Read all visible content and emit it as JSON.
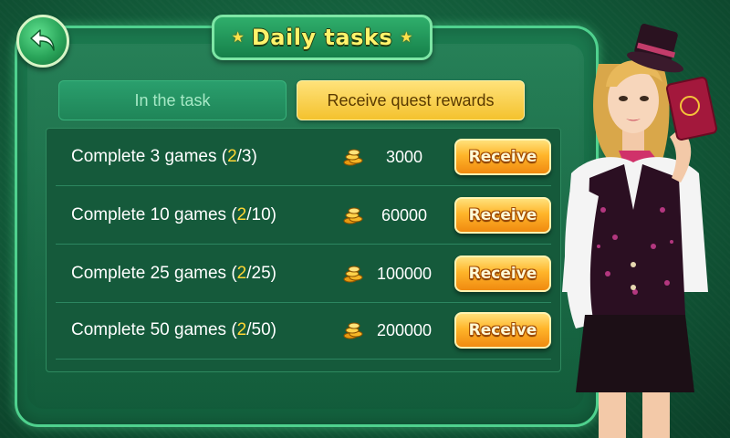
{
  "header": {
    "title": "Daily tasks",
    "star_glyph": "★",
    "back_icon": "back-arrow-icon"
  },
  "tabs": [
    {
      "label": "In the task",
      "active": false
    },
    {
      "label": "Receive quest rewards",
      "active": true
    }
  ],
  "tasks": [
    {
      "prefix": "Complete 3 games (",
      "done": "2",
      "suffix": "/3)",
      "reward": "3000",
      "button": "Receive"
    },
    {
      "prefix": "Complete 10 games (",
      "done": "2",
      "suffix": "/10)",
      "reward": "60000",
      "button": "Receive"
    },
    {
      "prefix": "Complete 25 games (",
      "done": "2",
      "suffix": "/25)",
      "reward": "100000",
      "button": "Receive"
    },
    {
      "prefix": "Complete 50 games (",
      "done": "2",
      "suffix": "/50)",
      "reward": "200000",
      "button": "Receive"
    }
  ],
  "colors": {
    "accent_gold": "#ffd634",
    "panel_green": "#1b7a4f",
    "button_orange": "#f08a10"
  }
}
